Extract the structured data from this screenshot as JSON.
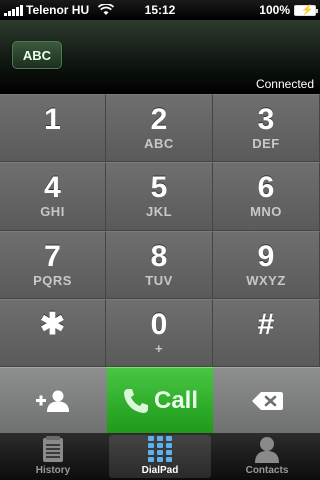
{
  "status_bar": {
    "carrier": "Telenor HU",
    "time": "15:12",
    "battery": "100%"
  },
  "display": {
    "mode_button": "ABC",
    "connection_status": "Connected"
  },
  "keypad": {
    "keys": [
      {
        "digit": "1",
        "letters": ""
      },
      {
        "digit": "2",
        "letters": "ABC"
      },
      {
        "digit": "3",
        "letters": "DEF"
      },
      {
        "digit": "4",
        "letters": "GHI"
      },
      {
        "digit": "5",
        "letters": "JKL"
      },
      {
        "digit": "6",
        "letters": "MNO"
      },
      {
        "digit": "7",
        "letters": "PQRS"
      },
      {
        "digit": "8",
        "letters": "TUV"
      },
      {
        "digit": "9",
        "letters": "WXYZ"
      },
      {
        "digit": "✱",
        "letters": ""
      },
      {
        "digit": "0",
        "letters": "+"
      },
      {
        "digit": "#",
        "letters": ""
      }
    ]
  },
  "actions": {
    "add_contact_icon": "add-contact-icon",
    "call_label": "Call",
    "delete_icon": "backspace-icon"
  },
  "tabbar": {
    "tabs": [
      {
        "label": "History",
        "icon": "history-icon",
        "active": false
      },
      {
        "label": "DialPad",
        "icon": "dialpad-icon",
        "active": true
      },
      {
        "label": "Contacts",
        "icon": "contacts-icon",
        "active": false
      }
    ]
  },
  "colors": {
    "call_green": "#2fb02a",
    "key_gray": "#666666",
    "display_green": "#2c3b2e"
  }
}
